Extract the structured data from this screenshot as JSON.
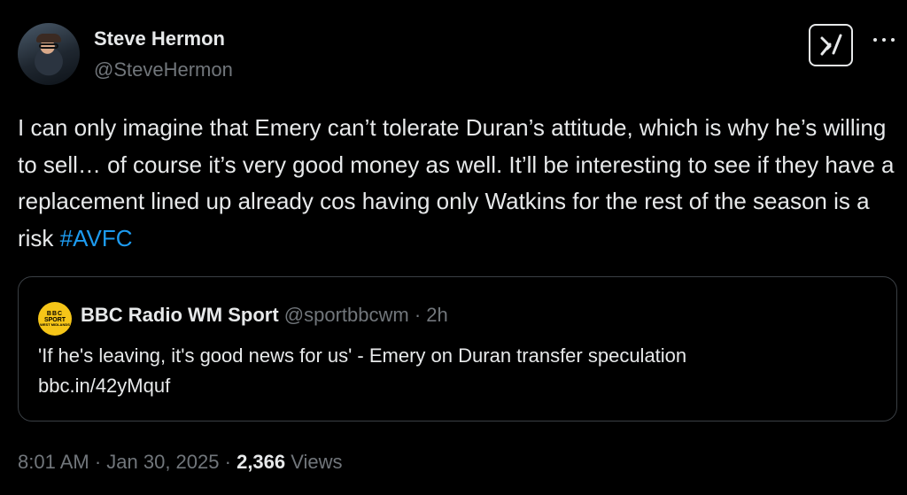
{
  "author": {
    "name": "Steve Hermon",
    "handle": "@SteveHermon"
  },
  "tweet": {
    "text": "I can only imagine that Emery can’t tolerate Duran’s attitude, which is why he’s willing to sell… of course it’s very good money as well. It’ll be interesting to see if they have a replacement lined up already cos having only Watkins for the rest of the season is a risk ",
    "hashtag": "#AVFC"
  },
  "quoted": {
    "name": "BBC Radio WM Sport",
    "handle": "@sportbbcwm",
    "separator": " · ",
    "age": "2h",
    "logo": {
      "line1": "BBC",
      "line2": "SPORT",
      "line3": "WEST MIDLANDS"
    },
    "text_line1": "'If he's leaving, it's good news for us' - Emery on Duran transfer speculation",
    "text_line2": "bbc.in/42yMquf"
  },
  "footer": {
    "time": "8:01 AM",
    "sep1": " · ",
    "date": "Jan 30, 2025",
    "sep2": " · ",
    "views_count": "2,366",
    "views_label": " Views"
  },
  "icons": {
    "grok": "grok-icon",
    "more": "more-icon"
  },
  "colors": {
    "background": "#000000",
    "text": "#e7e9ea",
    "muted": "#71767b",
    "link": "#1d9bf0",
    "border": "#3a3f44",
    "bbc_logo": "#f5c518"
  }
}
